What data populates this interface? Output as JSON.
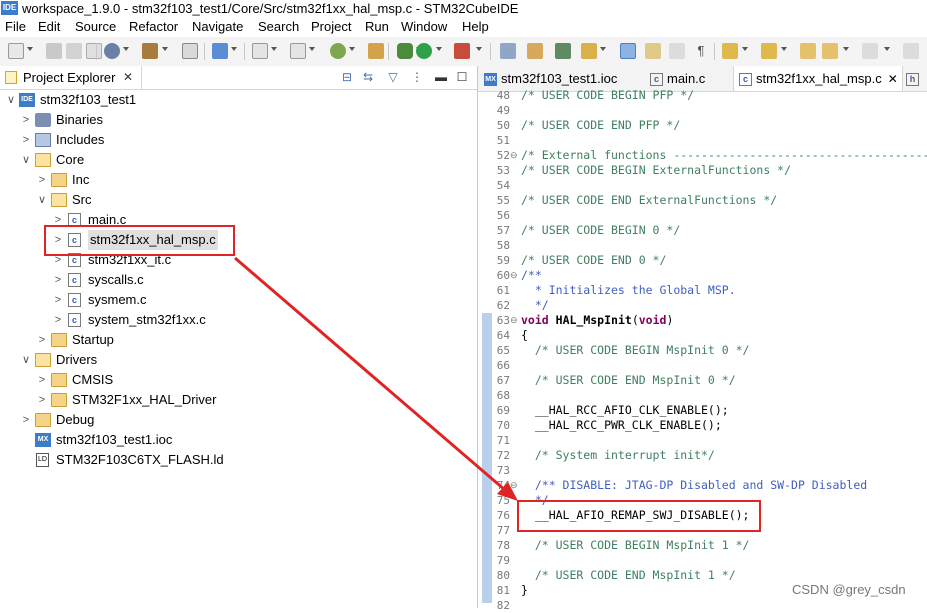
{
  "window": {
    "title": "workspace_1.9.0 - stm32f103_test1/Core/Src/stm32f1xx_hal_msp.c - STM32CubeIDE",
    "logo_text": "IDE"
  },
  "menu": [
    "File",
    "Edit",
    "Source",
    "Refactor",
    "Navigate",
    "Search",
    "Project",
    "Run",
    "Window",
    "Help"
  ],
  "project_explorer": {
    "tab_label": "Project Explorer",
    "close_glyph": "✕",
    "tree": [
      {
        "label": "stm32f103_test1",
        "icon": "ide-project-icon",
        "badge": "IDE",
        "arrow": "∨"
      },
      {
        "label": "Binaries",
        "icon": "binaries-icon",
        "arrow": ">"
      },
      {
        "label": "Includes",
        "icon": "includes-icon",
        "arrow": ">"
      },
      {
        "label": "Core",
        "icon": "folder-open-icon",
        "arrow": "∨"
      },
      {
        "label": "Inc",
        "icon": "folder-icon",
        "arrow": ">"
      },
      {
        "label": "Src",
        "icon": "folder-open-icon",
        "arrow": "∨"
      },
      {
        "label": "main.c",
        "icon": "c-file-icon",
        "badge": "c",
        "arrow": ">"
      },
      {
        "label": "stm32f1xx_hal_msp.c",
        "icon": "c-file-icon",
        "badge": "c",
        "arrow": ">"
      },
      {
        "label": "stm32f1xx_it.c",
        "icon": "c-file-icon",
        "badge": "c",
        "arrow": ">"
      },
      {
        "label": "syscalls.c",
        "icon": "c-file-icon",
        "badge": "c",
        "arrow": ">"
      },
      {
        "label": "sysmem.c",
        "icon": "c-file-icon",
        "badge": "c",
        "arrow": ">"
      },
      {
        "label": "system_stm32f1xx.c",
        "icon": "c-file-icon",
        "badge": "c",
        "arrow": ">"
      },
      {
        "label": "Startup",
        "icon": "folder-icon",
        "arrow": ">"
      },
      {
        "label": "Drivers",
        "icon": "folder-open-icon",
        "arrow": "∨"
      },
      {
        "label": "CMSIS",
        "icon": "folder-icon",
        "arrow": ">"
      },
      {
        "label": "STM32F1xx_HAL_Driver",
        "icon": "folder-icon",
        "arrow": ">"
      },
      {
        "label": "Debug",
        "icon": "folder-icon",
        "arrow": ">"
      },
      {
        "label": "stm32f103_test1.ioc",
        "icon": "mx-file-icon",
        "badge": "MX",
        "arrow": ""
      },
      {
        "label": "STM32F103C6TX_FLASH.ld",
        "icon": "ld-file-icon",
        "badge": "LD",
        "arrow": ""
      }
    ]
  },
  "editor": {
    "tabs": [
      {
        "label": "stm32f103_test1.ioc",
        "icon": "mx-file-icon",
        "badge": "MX"
      },
      {
        "label": "main.c",
        "icon": "c-file-icon",
        "badge": "c"
      },
      {
        "label": "stm32f1xx_hal_msp.c",
        "icon": "c-file-icon",
        "badge": "c",
        "close": "✕"
      },
      {
        "label": "h",
        "icon": "h-file-icon",
        "badge": "h"
      }
    ],
    "lines": [
      {
        "n": "48",
        "text": "/* USER CODE BEGIN PFP */",
        "kind": "cmt"
      },
      {
        "n": "49",
        "text": "",
        "kind": "plain"
      },
      {
        "n": "50",
        "text": "/* USER CODE END PFP */",
        "kind": "cmt"
      },
      {
        "n": "51",
        "text": "",
        "kind": "plain"
      },
      {
        "n": "52",
        "text": "/* External functions --------------------------------------",
        "kind": "cmt",
        "fold": "⊖"
      },
      {
        "n": "53",
        "text": "/* USER CODE BEGIN ExternalFunctions */",
        "kind": "cmt"
      },
      {
        "n": "54",
        "text": "",
        "kind": "plain"
      },
      {
        "n": "55",
        "text": "/* USER CODE END ExternalFunctions */",
        "kind": "cmt"
      },
      {
        "n": "56",
        "text": "",
        "kind": "plain"
      },
      {
        "n": "57",
        "text": "/* USER CODE BEGIN 0 */",
        "kind": "cmt"
      },
      {
        "n": "58",
        "text": "",
        "kind": "plain"
      },
      {
        "n": "59",
        "text": "/* USER CODE END 0 */",
        "kind": "cmt"
      },
      {
        "n": "60",
        "text": "/**",
        "kind": "jdoc",
        "fold": "⊖"
      },
      {
        "n": "61",
        "text": "  * Initializes the Global MSP.",
        "kind": "jdoc"
      },
      {
        "n": "62",
        "text": "  */",
        "kind": "jdoc"
      },
      {
        "n": "63",
        "text": "void HAL_MspInit(void)",
        "kind": "decl",
        "fold": "⊖"
      },
      {
        "n": "64",
        "text": "{",
        "kind": "plain"
      },
      {
        "n": "65",
        "text": "  /* USER CODE BEGIN MspInit 0 */",
        "kind": "cmt"
      },
      {
        "n": "66",
        "text": "",
        "kind": "plain"
      },
      {
        "n": "67",
        "text": "  /* USER CODE END MspInit 0 */",
        "kind": "cmt"
      },
      {
        "n": "68",
        "text": "",
        "kind": "plain"
      },
      {
        "n": "69",
        "text": "  __HAL_RCC_AFIO_CLK_ENABLE();",
        "kind": "plain"
      },
      {
        "n": "70",
        "text": "  __HAL_RCC_PWR_CLK_ENABLE();",
        "kind": "plain"
      },
      {
        "n": "71",
        "text": "",
        "kind": "plain"
      },
      {
        "n": "72",
        "text": "  /* System interrupt init*/",
        "kind": "cmt"
      },
      {
        "n": "73",
        "text": "",
        "kind": "plain"
      },
      {
        "n": "74",
        "text": "  /** DISABLE: JTAG-DP Disabled and SW-DP Disabled",
        "kind": "jdoc",
        "fold": "⊖"
      },
      {
        "n": "75",
        "text": "  */",
        "kind": "jdoc"
      },
      {
        "n": "76",
        "text": "  __HAL_AFIO_REMAP_SWJ_DISABLE();",
        "kind": "plain"
      },
      {
        "n": "77",
        "text": "",
        "kind": "plain"
      },
      {
        "n": "78",
        "text": "  /* USER CODE BEGIN MspInit 1 */",
        "kind": "cmt"
      },
      {
        "n": "79",
        "text": "",
        "kind": "plain"
      },
      {
        "n": "80",
        "text": "  /* USER CODE END MspInit 1 */",
        "kind": "cmt"
      },
      {
        "n": "81",
        "text": "}",
        "kind": "plain"
      },
      {
        "n": "82",
        "text": "",
        "kind": "plain"
      }
    ]
  },
  "watermark": "CSDN @grey_csdn",
  "colors": {
    "annotation_red": "#e02424",
    "comment_green": "#3f7f5f",
    "javadoc_blue": "#3f5fbf",
    "keyword_purple": "#7f0055",
    "ide_blue": "#3d7cc9"
  }
}
